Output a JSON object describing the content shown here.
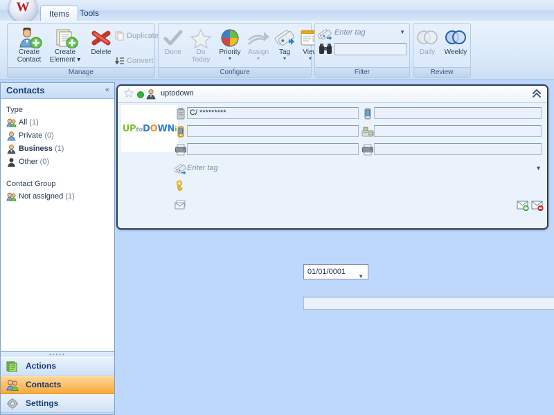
{
  "app": {
    "logo_letter": "W",
    "tabs": [
      {
        "label": "Items",
        "active": true
      },
      {
        "label": "Tools",
        "active": false
      }
    ]
  },
  "ribbon": {
    "groups": [
      {
        "name": "Manage",
        "label": "Manage",
        "buttons": [
          {
            "label_line1": "Create",
            "label_line2": "Contact",
            "icon": "user-add-icon",
            "enabled": true,
            "dropdown": false
          },
          {
            "label_line1": "Create",
            "label_line2": "Element",
            "icon": "document-add-icon",
            "enabled": true,
            "dropdown": true
          },
          {
            "label_line1": "Delete",
            "label_line2": "",
            "icon": "red-x-icon",
            "enabled": true,
            "dropdown": false
          }
        ],
        "small_buttons": [
          {
            "label": "Duplicate",
            "icon": "duplicate-icon",
            "enabled": false
          },
          {
            "label": "Convert",
            "icon": "convert-icon",
            "enabled": false
          }
        ]
      },
      {
        "name": "Configure",
        "label": "Configure",
        "buttons": [
          {
            "label_line1": "Done",
            "label_line2": "",
            "icon": "checkmark-icon",
            "enabled": false,
            "dropdown": false
          },
          {
            "label_line1": "Do",
            "label_line2": "Today",
            "icon": "star-icon",
            "enabled": false,
            "dropdown": false
          },
          {
            "label_line1": "Priority",
            "label_line2": "",
            "icon": "priority-pinwheel-icon",
            "enabled": true,
            "dropdown": true
          },
          {
            "label_line1": "Assign",
            "label_line2": "",
            "icon": "assign-arrow-icon",
            "enabled": false,
            "dropdown": true
          },
          {
            "label_line1": "Tag",
            "label_line2": "",
            "icon": "tag-icon",
            "enabled": true,
            "dropdown": true
          },
          {
            "label_line1": "View",
            "label_line2": "",
            "icon": "view-card-icon",
            "enabled": true,
            "dropdown": true
          }
        ]
      },
      {
        "name": "Filter",
        "label": "Filter",
        "tag_placeholder": "Enter tag",
        "tag_value": "",
        "search_value": "",
        "tag_icon": "tag-icon",
        "search_icon": "binoculars-icon"
      },
      {
        "name": "Review",
        "label": "Review",
        "buttons": [
          {
            "label_line1": "Daily",
            "label_line2": "",
            "icon": "daily-circles-icon",
            "enabled": false,
            "dropdown": false
          },
          {
            "label_line1": "Weekly",
            "label_line2": "",
            "icon": "weekly-circles-icon",
            "enabled": true,
            "dropdown": false
          }
        ]
      }
    ]
  },
  "sidebar": {
    "title": "Contacts",
    "collapse_icon": "chevron-double-left-icon",
    "sections": [
      {
        "title": "Type",
        "items": [
          {
            "label": "All",
            "count": "(1)",
            "icon": "users-group-icon",
            "selected": false
          },
          {
            "label": "Private",
            "count": "(0)",
            "icon": "user-blue-icon",
            "selected": false
          },
          {
            "label": "Business",
            "count": "(1)",
            "icon": "user-suit-icon",
            "selected": true
          },
          {
            "label": "Other",
            "count": "(0)",
            "icon": "user-dark-icon",
            "selected": false
          }
        ]
      },
      {
        "title": "Contact Group",
        "items": [
          {
            "label": "Not assigned",
            "count": "(1)",
            "icon": "users-group-icon",
            "selected": false
          }
        ]
      }
    ]
  },
  "navpane": {
    "items": [
      {
        "label": "Actions",
        "icon": "stack-list-icon",
        "selected": false
      },
      {
        "label": "Contacts",
        "icon": "users-group-icon",
        "selected": true
      },
      {
        "label": "Settings",
        "icon": "gear-icon",
        "selected": false
      }
    ]
  },
  "card": {
    "title": "uptodown",
    "star_icon": "star-outline-icon",
    "status_icon": "green-dot-icon",
    "type_icon": "user-suit-icon",
    "collapse_icon": "chevron-double-up-icon",
    "logo": {
      "part1": "UP",
      "part2": "to",
      "part3": "D",
      "part4": "O",
      "part5": "WN",
      "part6": "i"
    },
    "fields_left": [
      {
        "icon": "address-building-icon",
        "value": "C/ *********",
        "placeholder": ""
      },
      {
        "icon": "mobile-orange-icon",
        "value": "",
        "placeholder": ""
      },
      {
        "icon": "fax-icon",
        "value": "",
        "placeholder": ""
      }
    ],
    "fields_right": [
      {
        "icon": "cellphone-icon",
        "value": "",
        "placeholder": ""
      },
      {
        "icon": "deskphone-icon",
        "value": "",
        "placeholder": ""
      },
      {
        "icon": "fax-icon",
        "value": "",
        "placeholder": ""
      }
    ],
    "tag": {
      "icon": "tag-icon",
      "placeholder": "Enter tag",
      "value": "",
      "dropdown_icon": "chevron-down-icon"
    },
    "date": {
      "icon": "birthday-icon",
      "value": "01/01/0001",
      "dropdown_icon": "chevron-down-icon"
    },
    "email": {
      "icon": "envelope-open-icon",
      "value": "",
      "add_icon": "envelope-add-icon",
      "remove_icon": "envelope-remove-icon"
    }
  },
  "colors": {
    "workspace": "#bed8fc",
    "accent_selected": "#f9a93c",
    "card_border": "#2c3e5c",
    "status_green": "#31b53a"
  }
}
